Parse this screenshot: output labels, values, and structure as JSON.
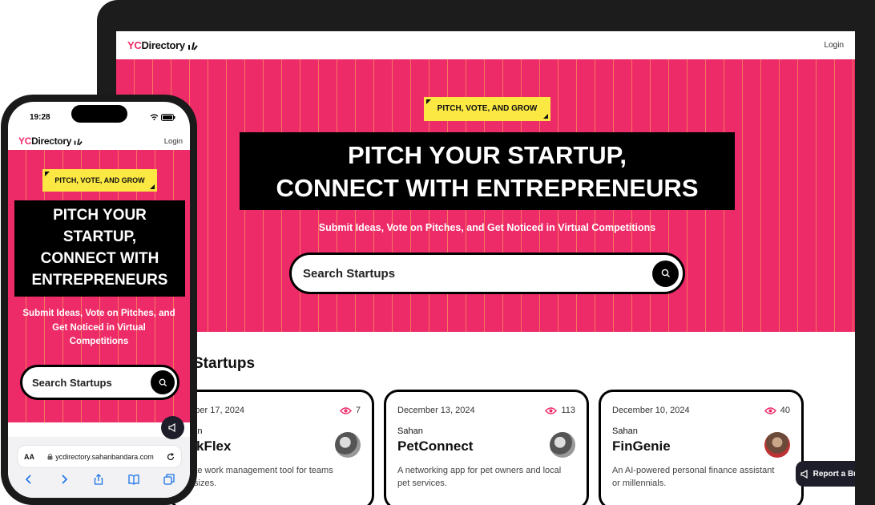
{
  "brand": {
    "prefix": "YC",
    "suffix": "Directory",
    "accent": "#ee2b69",
    "yellow": "#fbe843"
  },
  "laptop": {
    "nav": {
      "login": "Login"
    },
    "hero": {
      "tag": "PITCH, VOTE, AND GROW",
      "headline": [
        "PITCH YOUR STARTUP,",
        "CONNECT WITH ENTREPRENEURS"
      ],
      "subtitle": "Submit Ideas, Vote on Pitches, and Get Noticed in Virtual Competitions",
      "search_placeholder": "Search Startups"
    },
    "section_title": "Startups",
    "cards": [
      {
        "date": "ember 17, 2024",
        "views": "7",
        "author": "ahan",
        "title": "orkFlex",
        "desc": [
          "mote work management tool for teams",
          "all sizes."
        ]
      },
      {
        "date": "December 13, 2024",
        "views": "113",
        "author": "Sahan",
        "title": "PetConnect",
        "desc": [
          "A networking app for pet owners and local",
          "pet services."
        ]
      },
      {
        "date": "December 10, 2024",
        "views": "40",
        "author": "Sahan",
        "title": "FinGenie",
        "desc": [
          "An AI-powered personal finance assistant",
          "or millennials."
        ]
      }
    ],
    "report_bug": "Report a Bug"
  },
  "phone": {
    "time": "19:28",
    "nav": {
      "login": "Login"
    },
    "hero": {
      "tag": "PITCH, VOTE, AND GROW",
      "headline": [
        "PITCH YOUR",
        "STARTUP,",
        "CONNECT WITH",
        "ENTREPRENEURS"
      ],
      "subtitle": [
        "Submit Ideas, Vote on Pitches, and",
        "Get Noticed in Virtual",
        "Competitions"
      ],
      "search_placeholder": "Search Startups"
    },
    "browser": {
      "aa": "AA",
      "url": "ycdirectory.sahanbandara.com"
    }
  }
}
